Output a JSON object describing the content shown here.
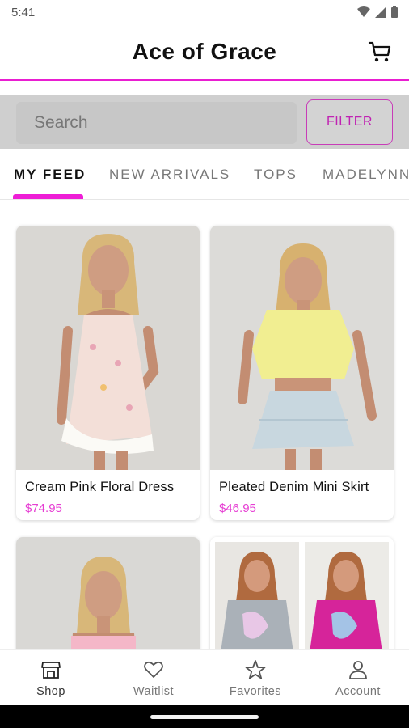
{
  "status_bar": {
    "time": "5:41"
  },
  "header": {
    "title": "Ace of Grace"
  },
  "search": {
    "placeholder": "Search",
    "filter_label": "FILTER"
  },
  "tabs": [
    {
      "label": "MY FEED",
      "active": true
    },
    {
      "label": "NEW ARRIVALS",
      "active": false
    },
    {
      "label": "TOPS",
      "active": false
    },
    {
      "label": "MADELYNN",
      "active": false
    }
  ],
  "products": [
    {
      "title": "Cream Pink Floral Dress",
      "price": "$74.95"
    },
    {
      "title": "Pleated Denim Mini Skirt",
      "price": "$46.95"
    },
    {
      "title": "",
      "price": ""
    },
    {
      "title": "",
      "price": ""
    }
  ],
  "bottom_nav": [
    {
      "label": "Shop",
      "icon": "shop-icon",
      "active": true
    },
    {
      "label": "Waitlist",
      "icon": "heart-icon",
      "active": false
    },
    {
      "label": "Favorites",
      "icon": "star-icon",
      "active": false
    },
    {
      "label": "Account",
      "icon": "account-icon",
      "active": false
    }
  ],
  "colors": {
    "accent": "#e91ed1",
    "price": "#e63fd3",
    "filter_border": "#c83cb8"
  }
}
